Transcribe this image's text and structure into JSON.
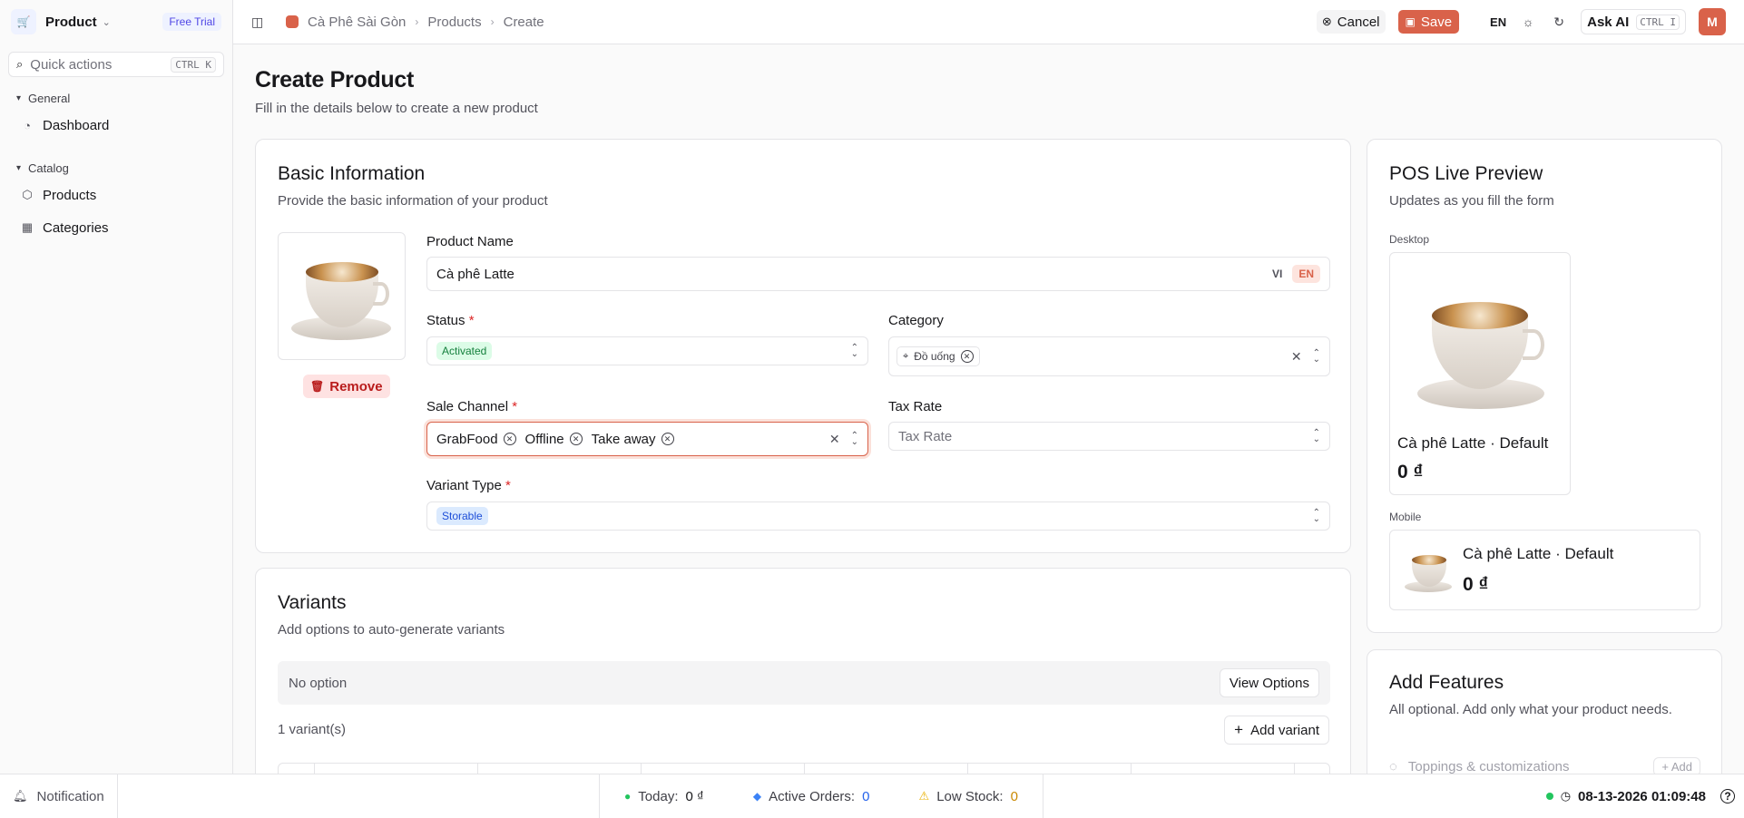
{
  "sidebar": {
    "app_title": "Product",
    "trial_badge": "Free Trial",
    "search_placeholder": "Quick actions",
    "search_shortcut": "CTRL K",
    "groups": [
      {
        "label": "General",
        "items": [
          {
            "label": "Dashboard",
            "icon": "dashboard-icon"
          }
        ]
      },
      {
        "label": "Catalog",
        "items": [
          {
            "label": "Products",
            "icon": "box-icon"
          },
          {
            "label": "Categories",
            "icon": "grid-icon"
          }
        ]
      }
    ]
  },
  "topbar": {
    "breadcrumb": [
      "Cà Phê Sài Gòn",
      "Products",
      "Create"
    ],
    "cancel_label": "Cancel",
    "save_label": "Save",
    "language": "EN",
    "ask_ai_label": "Ask AI",
    "ask_ai_shortcut": "CTRL I",
    "avatar_initial": "M"
  },
  "page": {
    "title": "Create Product",
    "subtitle": "Fill in the details below to create a new product"
  },
  "basic_info": {
    "title": "Basic Information",
    "subtitle": "Provide the basic information of your product",
    "remove_label": "Remove",
    "product_name_label": "Product Name",
    "product_name_value": "Cà phê Latte",
    "lang_vi": "VI",
    "lang_en": "EN",
    "status_label": "Status",
    "status_value": "Activated",
    "category_label": "Category",
    "category_value": "Đồ uống",
    "sale_channel_label": "Sale Channel",
    "sale_channels": [
      "GrabFood",
      "Offline",
      "Take away"
    ],
    "tax_rate_label": "Tax Rate",
    "tax_rate_placeholder": "Tax Rate",
    "variant_type_label": "Variant Type",
    "variant_type_value": "Storable"
  },
  "variants": {
    "title": "Variants",
    "subtitle": "Add options to auto-generate variants",
    "no_option": "No option",
    "view_options_label": "View Options",
    "count_text": "1 variant(s)",
    "add_variant_label": "Add variant"
  },
  "preview": {
    "title": "POS Live Preview",
    "subtitle": "Updates as you fill the form",
    "desktop_label": "Desktop",
    "mobile_label": "Mobile",
    "item_name": "Cà phê Latte · Default",
    "item_price": "0 ₫"
  },
  "features": {
    "title": "Add Features",
    "subtitle": "All optional. Add only what your product needs.",
    "first_feature": "Toppings & customizations",
    "add_label": "Add"
  },
  "statusbar": {
    "notification_label": "Notification",
    "today_label": "Today:",
    "today_value": "0 ₫",
    "active_orders_label": "Active Orders:",
    "active_orders_value": "0",
    "low_stock_label": "Low Stock:",
    "low_stock_value": "0",
    "datetime": "08-13-2026 01:09:48"
  },
  "colors": {
    "accent": "#d9624a",
    "brand": "#4f46e5",
    "success": "#15803d"
  }
}
